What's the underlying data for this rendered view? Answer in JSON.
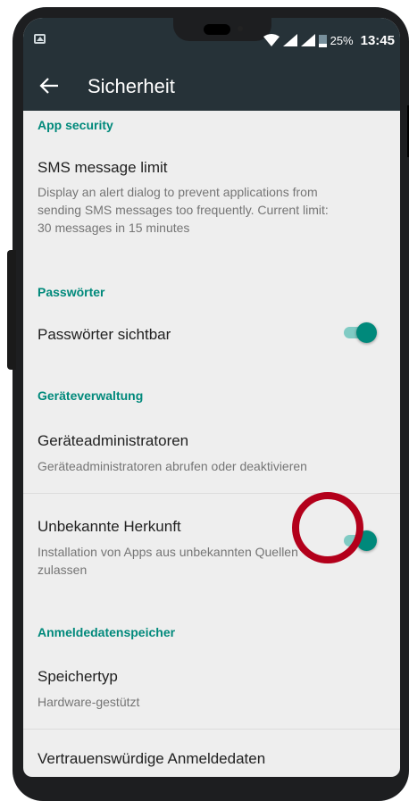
{
  "status_bar": {
    "battery_percent": "25%",
    "time": "13:45"
  },
  "toolbar": {
    "title": "Sicherheit"
  },
  "sections": {
    "app_security": {
      "header": "App security",
      "sms_limit_title": "SMS message limit",
      "sms_limit_desc": "Display an alert dialog to prevent applications from sending SMS messages too frequently. Current limit: 30 messages in 15 minutes"
    },
    "passwords": {
      "header": "Passwörter",
      "visible_title": "Passwörter sichtbar",
      "visible_on": true
    },
    "device_admin": {
      "header": "Geräteverwaltung",
      "admins_title": "Geräteadministratoren",
      "admins_desc": "Geräteadministratoren abrufen oder deaktivieren",
      "unknown_title": "Unbekannte Herkunft",
      "unknown_desc": "Installation von Apps aus unbekannten Quellen zulassen",
      "unknown_on": true
    },
    "credential_storage": {
      "header": "Anmeldedatenspeicher",
      "storage_type_title": "Speichertyp",
      "storage_type_desc": "Hardware-gestützt",
      "trusted_title": "Vertrauenswürdige Anmeldedaten"
    }
  },
  "colors": {
    "accent": "#00897b",
    "toolbar": "#263238",
    "highlight": "#b3001b"
  }
}
